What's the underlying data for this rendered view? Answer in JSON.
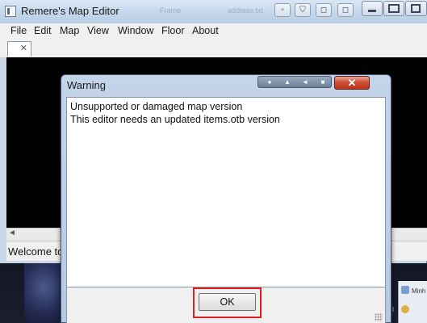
{
  "window": {
    "title": "Remere's Map Editor",
    "ghost_labels": [
      "Frame",
      "address.txt"
    ],
    "controls": [
      "minimize",
      "restore",
      "close"
    ],
    "toolbar_glyphs": [
      "▫",
      "⛉",
      "◻",
      "◻"
    ]
  },
  "menu": {
    "items": [
      "File",
      "Edit",
      "Map",
      "View",
      "Window",
      "Floor",
      "About"
    ]
  },
  "tabs": {
    "close_glyph": "✕"
  },
  "scroll": {
    "left_arrow": "◄"
  },
  "status": {
    "text": "Welcome to"
  },
  "dialog": {
    "title": "Warning",
    "close_glyph": "✕",
    "message_lines": [
      "Unsupported or damaged map version",
      "This editor needs an updated items.otb version"
    ],
    "ok_label": "OK"
  },
  "taskbar": {
    "side_label": "Minh"
  },
  "colors": {
    "highlight": "#e0201d",
    "close_button": "#d0523a",
    "titlebar": "#c7d8ec",
    "canvas": "#000000"
  }
}
